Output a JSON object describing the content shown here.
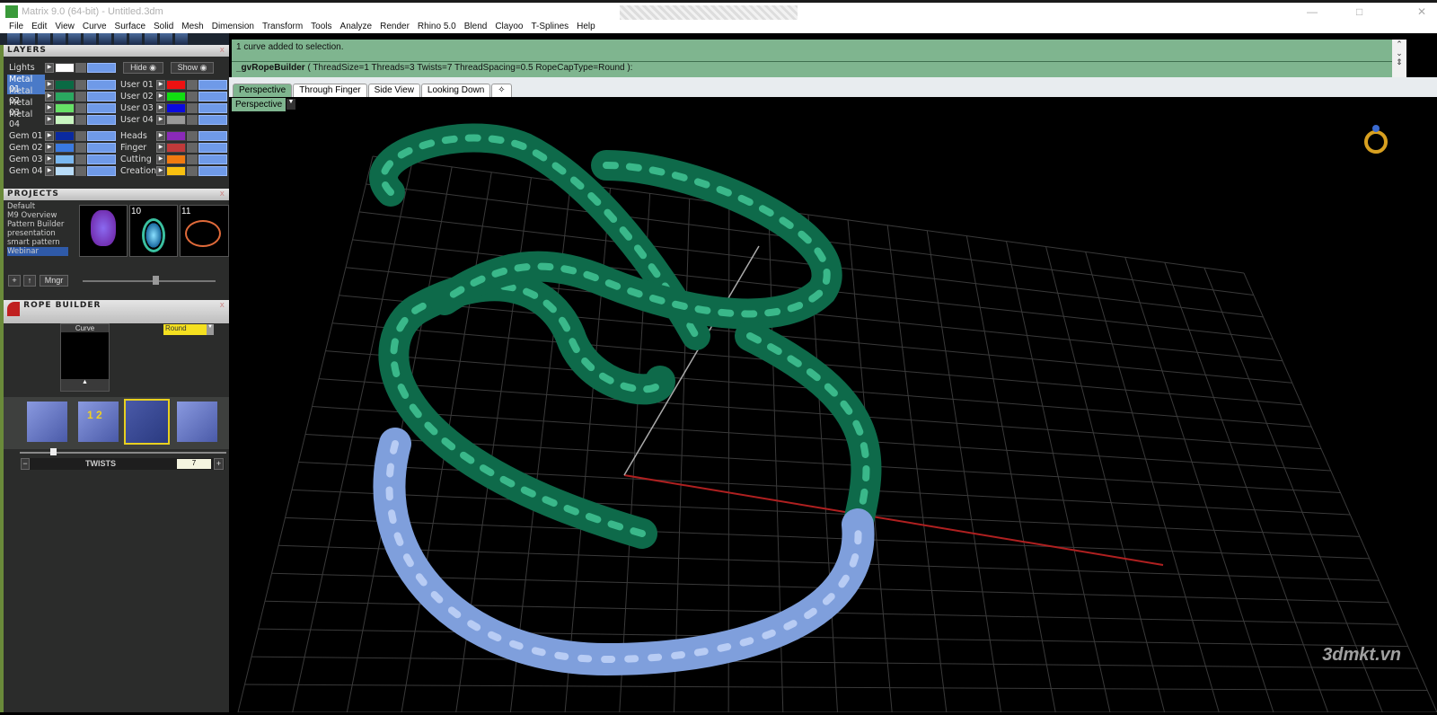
{
  "window": {
    "title": "Matrix 9.0 (64-bit) - Untitled.3dm",
    "minimize": "—",
    "maximize": "□",
    "close": "✕"
  },
  "menu": [
    "File",
    "Edit",
    "View",
    "Curve",
    "Surface",
    "Solid",
    "Mesh",
    "Dimension",
    "Transform",
    "Tools",
    "Analyze",
    "Render",
    "Rhino 5.0",
    "Blend",
    "Clayoo",
    "T-Splines",
    "Help"
  ],
  "layers": {
    "title": "LAYERS",
    "close": "x",
    "hide": "Hide",
    "show": "Show",
    "lights": {
      "name": "Lights",
      "color": "#ffffff"
    },
    "left": [
      {
        "name": "Metal 01",
        "color": "#0a6a44",
        "selected": true
      },
      {
        "name": "Metal 02",
        "color": "#2aa860"
      },
      {
        "name": "Metal 03",
        "color": "#66e066"
      },
      {
        "name": "Metal 04",
        "color": "#c8f5c0"
      },
      {
        "name": "Gem 01",
        "color": "#0a2aa0"
      },
      {
        "name": "Gem 02",
        "color": "#3a7ae0"
      },
      {
        "name": "Gem 03",
        "color": "#7ab8f0"
      },
      {
        "name": "Gem 04",
        "color": "#b8dcf8"
      }
    ],
    "right": [
      {
        "name": "User 01",
        "color": "#ee1111"
      },
      {
        "name": "User 02",
        "color": "#11dd11"
      },
      {
        "name": "User 03",
        "color": "#0a0ae0"
      },
      {
        "name": "User 04",
        "color": "#999999"
      },
      {
        "name": "Heads",
        "color": "#8a2ab8"
      },
      {
        "name": "Finger",
        "color": "#c03a3a"
      },
      {
        "name": "Cutting",
        "color": "#f07a10"
      },
      {
        "name": "Creation",
        "color": "#f8c010"
      }
    ]
  },
  "projects": {
    "title": "PROJECTS",
    "close": "x",
    "items": [
      "Default",
      "M9 Overview",
      "Pattern Builder",
      "presentation",
      "smart pattern",
      "Webinar"
    ],
    "selected": "Webinar",
    "thumbs": [
      "",
      "10",
      "11"
    ],
    "add": "+",
    "up": "↑",
    "manager": "Mngr"
  },
  "rope_builder": {
    "title": "ROPE BUILDER",
    "close": "x",
    "curve_label": "Curve",
    "cap_type": "Round",
    "param_label": "TWISTS",
    "param_value": "7",
    "minus": "−",
    "plus": "+"
  },
  "command": {
    "history": "1 curve added to selection.",
    "prompt_cmd": "_gvRopeBuilder",
    "prompt_args": "( ThreadSize=1  Threads=3  Twists=7  ThreadSpacing=0.5  RopeCapType=Round ):"
  },
  "viewport_tabs": [
    "Perspective",
    "Through Finger",
    "Side View",
    "Looking Down",
    "✧"
  ],
  "active_tab": "Perspective",
  "viewport_label": "Perspective",
  "watermark": "3dmkt.vn",
  "colors": {
    "accent_green": "#7fb58f",
    "rope_green": "#0e6a4a",
    "rope_blue": "#7f9fdc"
  }
}
